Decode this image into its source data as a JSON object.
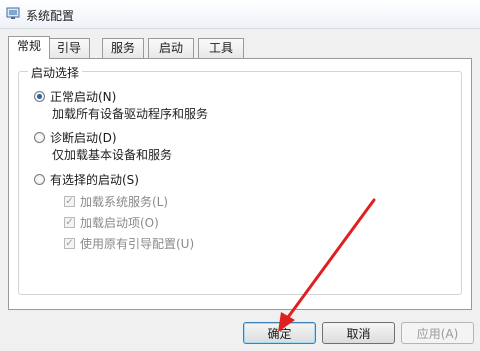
{
  "window": {
    "title": "系统配置",
    "icon": "system-config-icon"
  },
  "tabs": [
    {
      "label": "常规",
      "active": true
    },
    {
      "label": "引导",
      "active": false
    },
    {
      "label": "服务",
      "active": false
    },
    {
      "label": "启动",
      "active": false
    },
    {
      "label": "工具",
      "active": false
    }
  ],
  "startup": {
    "group_label": "启动选择",
    "options": [
      {
        "label": "正常启动(N)",
        "desc": "加载所有设备驱动程序和服务",
        "selected": true
      },
      {
        "label": "诊断启动(D)",
        "desc": "仅加载基本设备和服务",
        "selected": false
      },
      {
        "label": "有选择的启动(S)",
        "selected": false
      }
    ],
    "selective": [
      {
        "label": "加载系统服务(L)",
        "checked": true,
        "enabled": false
      },
      {
        "label": "加载启动项(O)",
        "checked": true,
        "enabled": false
      },
      {
        "label": "使用原有引导配置(U)",
        "checked": true,
        "enabled": false
      }
    ]
  },
  "buttons": {
    "ok": "确定",
    "cancel": "取消",
    "apply": "应用(A)"
  },
  "annotation": {
    "arrow_color": "#e02020"
  }
}
